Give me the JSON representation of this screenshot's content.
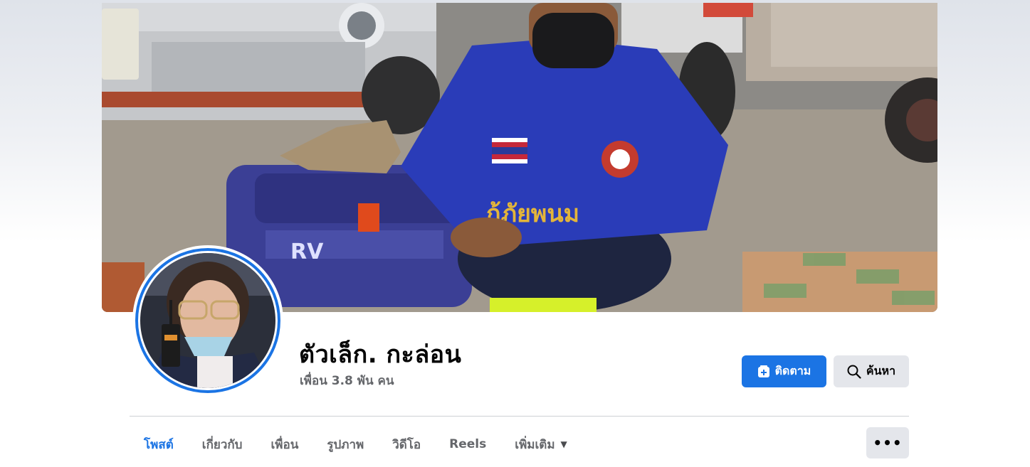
{
  "profile": {
    "name": "ตัวเล็ก. กะล่อน",
    "friends": "เพื่อน 3.8 พัน คน"
  },
  "actions": {
    "follow_label": "ติดตาม",
    "search_label": "ค้นหา"
  },
  "tabs": [
    {
      "label": "โพสต์",
      "active": true
    },
    {
      "label": "เกี่ยวกับ",
      "active": false
    },
    {
      "label": "เพื่อน",
      "active": false
    },
    {
      "label": "รูปภาพ",
      "active": false
    },
    {
      "label": "วิดีโอ",
      "active": false
    },
    {
      "label": "Reels",
      "active": false
    },
    {
      "label": "เพิ่มเติม",
      "active": false
    }
  ],
  "icons": {
    "follow": "user-plus-icon",
    "search": "search-icon",
    "more_caret": "caret-down-icon",
    "overflow": "more-horizontal-icon"
  },
  "cover": {
    "shirt_text": "กู้ภัยพนม"
  },
  "colors": {
    "accent": "#1b74e4",
    "secondary_button": "#e4e6eb",
    "muted_text": "#65676b"
  }
}
